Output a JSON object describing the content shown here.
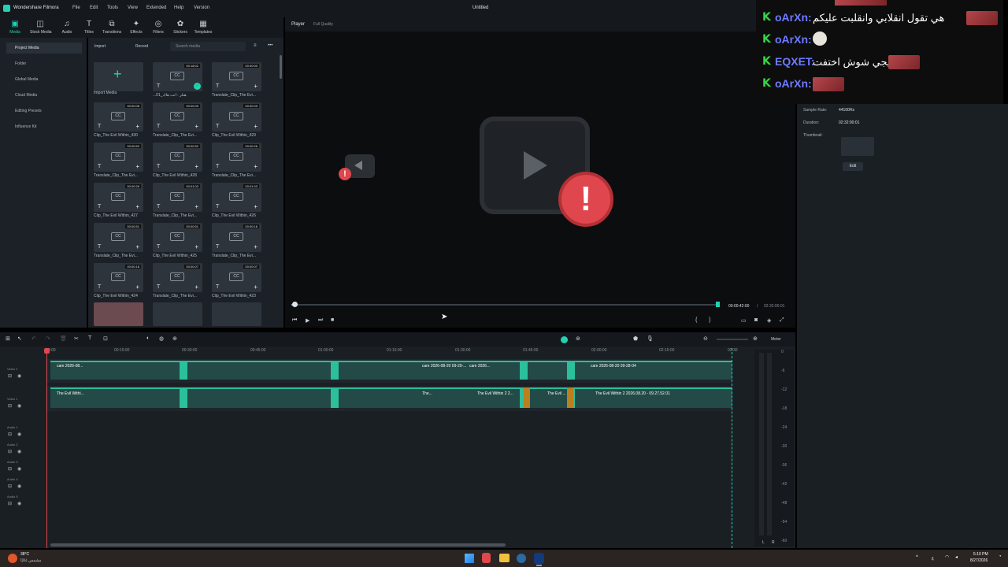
{
  "app": {
    "name": "Wondershare Filmora",
    "title": "Untitled"
  },
  "menu": [
    "File",
    "Edit",
    "Tools",
    "View",
    "Extended",
    "Help",
    "Version"
  ],
  "toolbar": [
    {
      "label": "Media",
      "icon": "media-icon",
      "active": true
    },
    {
      "label": "Stock Media",
      "icon": "stock-media-icon"
    },
    {
      "label": "Audio",
      "icon": "audio-icon"
    },
    {
      "label": "Titles",
      "icon": "titles-icon"
    },
    {
      "label": "Transitions",
      "icon": "transitions-icon"
    },
    {
      "label": "Effects",
      "icon": "effects-icon"
    },
    {
      "label": "Filters",
      "icon": "filters-icon"
    },
    {
      "label": "Stickers",
      "icon": "stickers-icon"
    },
    {
      "label": "Templates",
      "icon": "templates-icon"
    }
  ],
  "leftnav": [
    {
      "label": "Project Media",
      "selected": true
    },
    {
      "label": "Folder"
    },
    {
      "label": "Global Media"
    },
    {
      "label": "Cloud Media"
    },
    {
      "label": "Editing Presets"
    },
    {
      "label": "Influence Kit"
    }
  ],
  "media": {
    "import_label": "Import",
    "record_label": "Record",
    "search_placeholder": "Search media",
    "import_media_label": "Import Media",
    "items": [
      {
        "name": "...هتلر : أنت هاك_01",
        "dur": "00:18:02",
        "checked": true
      },
      {
        "name": "Translate_Clip_The Evi...",
        "dur": "00:00:00"
      },
      {
        "name": "Clip_The Evil Within_430",
        "dur": "00:00:08"
      },
      {
        "name": "Translate_Clip_The Evi...",
        "dur": "00:00:09"
      },
      {
        "name": "Clip_The Evil Within_429",
        "dur": "00:00:09"
      },
      {
        "name": "Translate_Clip_The Evi...",
        "dur": "00:00:52"
      },
      {
        "name": "Clip_The Evil Within_428",
        "dur": "00:00:52"
      },
      {
        "name": "Translate_Clip_The Evi...",
        "dur": "00:00:26"
      },
      {
        "name": "Clip_The Evil Within_427",
        "dur": "00:00:26"
      },
      {
        "name": "Translate_Clip_The Evi...",
        "dur": "00:01:03"
      },
      {
        "name": "Clip_The Evil Within_426",
        "dur": "00:01:03"
      },
      {
        "name": "Translate_Clip_The Evi...",
        "dur": "00:00:51"
      },
      {
        "name": "Clip_The Evil Within_425",
        "dur": "00:00:51"
      },
      {
        "name": "Translate_Clip_The Evi...",
        "dur": "00:00:16"
      },
      {
        "name": "Clip_The Evil Within_424",
        "dur": "00:00:18"
      },
      {
        "name": "Translate_Clip_The Evi...",
        "dur": "00:00:07"
      },
      {
        "name": "Clip_The Evil Within_423",
        "dur": "00:00:07"
      }
    ]
  },
  "player": {
    "label": "Player",
    "quality": "Full Quality",
    "current_time": "00:00:42:00",
    "total_time": "02:32:00:01"
  },
  "timeline": {
    "meter_label": "Meter",
    "ruler": [
      "00:00",
      "00:15:00",
      "00:30:00",
      "00:45:00",
      "01:00:00",
      "01:15:00",
      "01:30:00",
      "01:45:00",
      "02:00:00",
      "02:15:00",
      "02:30"
    ],
    "tracks": [
      "Video 2",
      "Video 1",
      "Audio 1",
      "Audio 2",
      "Audio 3",
      "Audio 4",
      "Audio 5"
    ],
    "clips_v2": [
      "cam 2026-08...",
      "cam 2026-08-20 09-29-...",
      "cam 2026...",
      "cam 2026-08-20 09-28-04"
    ],
    "clips_v1": [
      "The Evil Withi...",
      "The...",
      "The Evil Within 2 2...",
      "The Evil ...",
      "The Evil Within 2 2026.08.20 - 09.27.52.01"
    ],
    "meter_scale": [
      "0",
      "-6",
      "-12",
      "-18",
      "-24",
      "-30",
      "-36",
      "-42",
      "-48",
      "-54",
      "-60"
    ],
    "meter_lr": [
      "L",
      "R"
    ]
  },
  "properties": {
    "sample_rate_label": "Sample Rate:",
    "sample_rate": "44100Hz",
    "duration_label": "Duration:",
    "duration": "02:32:00:01",
    "thumbnail_label": "Thumbnail:",
    "edit_label": "Edit"
  },
  "chat": [
    {
      "name": "oArXn:",
      "msg": "هي تقول انقلابي وانقلبت عليكم",
      "emote": true
    },
    {
      "name": "oArXn:",
      "msg": "",
      "emote": false,
      "face": true
    },
    {
      "name": "EQXET:",
      "msg": "جيجي شوش اختفت",
      "emote": true
    },
    {
      "name": "oArXn:",
      "msg": "",
      "emote": true
    }
  ],
  "taskbar": {
    "temp": "38°C",
    "weather": "مشمس غالبًا",
    "time": "5:10 PM",
    "date": "8/27/2026",
    "lang": "ع"
  }
}
